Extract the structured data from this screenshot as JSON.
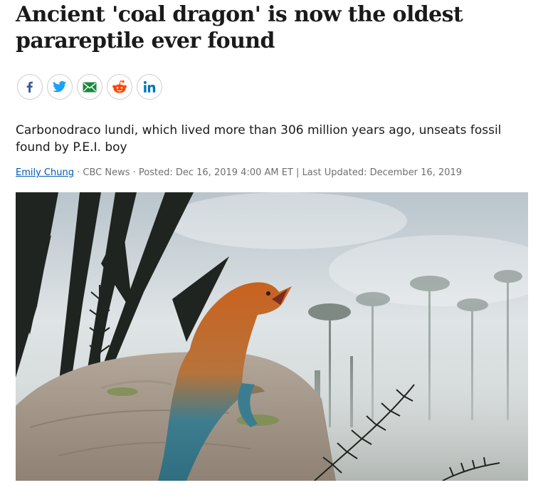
{
  "article": {
    "headline": "Ancient 'coal dragon' is now the oldest parareptile ever found",
    "deck": "Carbonodraco lundi, which lived more than 306 million years ago, unseats fossil found by P.E.I. boy",
    "byline": {
      "author": "Emily Chung",
      "sep1": " · ",
      "source": "CBC News",
      "sep2": " · ",
      "posted": "Posted: Dec 16, 2019 4:00 AM ET",
      "sep3": " | ",
      "updated": "Last Updated: December 16, 2019"
    }
  },
  "share": [
    {
      "name": "facebook",
      "icon": "facebook-icon",
      "color": "#3b5998"
    },
    {
      "name": "twitter",
      "icon": "twitter-icon",
      "color": "#1da1f2"
    },
    {
      "name": "email",
      "icon": "mail-icon",
      "color": "#1a8a3c"
    },
    {
      "name": "reddit",
      "icon": "reddit-icon",
      "color": "#ff4500"
    },
    {
      "name": "linkedin",
      "icon": "linkedin-icon",
      "color": "#0077b5"
    }
  ],
  "colors": {
    "link": "#0059b3",
    "meta": "#6f6f6f",
    "text": "#1a1a1a"
  }
}
